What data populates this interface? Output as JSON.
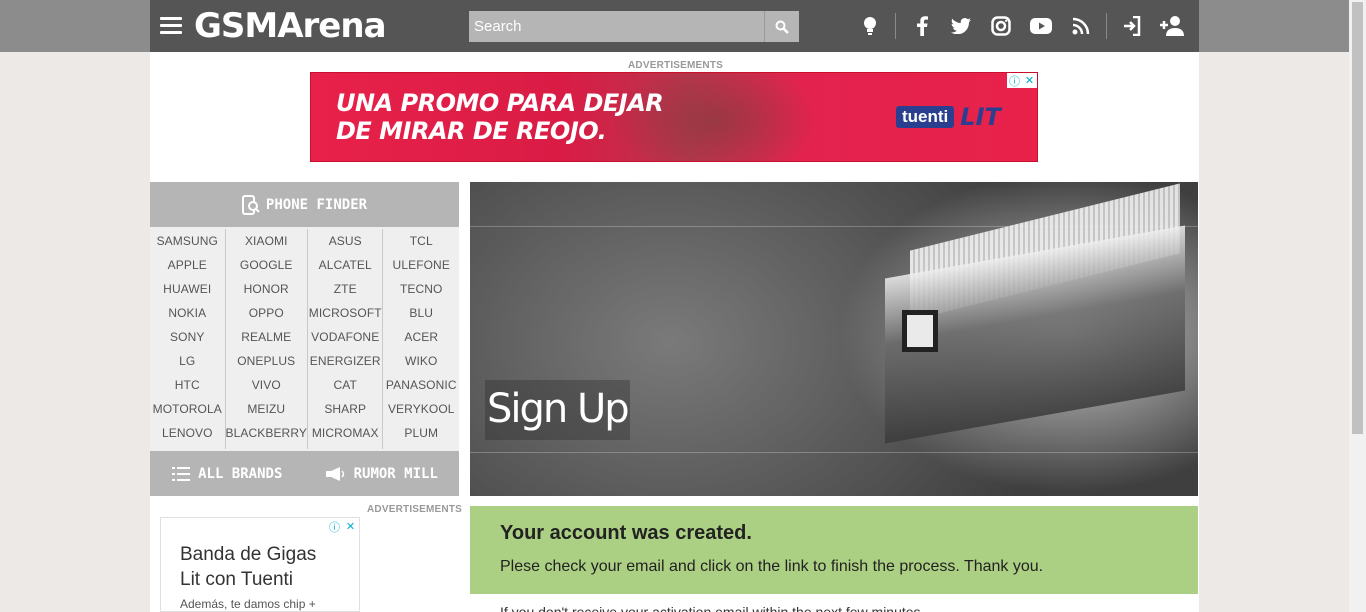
{
  "header": {
    "logo": "GSMArena",
    "search_placeholder": "Search"
  },
  "ads": {
    "label": "ADVERTISEMENTS",
    "top": {
      "line1": "UNA PROMO PARA DEJAR",
      "line2": "DE MIRAR DE REOJO.",
      "brand": "tuenti",
      "brand_suffix": "LIT"
    },
    "side": {
      "title_line1": "Banda de Gigas",
      "title_line2": "Lit con Tuenti",
      "subtitle": "Además, te damos chip +"
    }
  },
  "finder": {
    "title": "PHONE FINDER",
    "brand_columns": [
      [
        "SAMSUNG",
        "APPLE",
        "HUAWEI",
        "NOKIA",
        "SONY",
        "LG",
        "HTC",
        "MOTOROLA",
        "LENOVO"
      ],
      [
        "XIAOMI",
        "GOOGLE",
        "HONOR",
        "OPPO",
        "REALME",
        "ONEPLUS",
        "VIVO",
        "MEIZU",
        "BLACKBERRY"
      ],
      [
        "ASUS",
        "ALCATEL",
        "ZTE",
        "MICROSOFT",
        "VODAFONE",
        "ENERGIZER",
        "CAT",
        "SHARP",
        "MICROMAX"
      ],
      [
        "TCL",
        "ULEFONE",
        "TECNO",
        "BLU",
        "ACER",
        "WIKO",
        "PANASONIC",
        "VERYKOOL",
        "PLUM"
      ]
    ],
    "all_brands": "ALL BRANDS",
    "rumor_mill": "RUMOR MILL"
  },
  "hero": {
    "title": "Sign Up"
  },
  "success": {
    "title": "Your account was created.",
    "message": "Plese check your email and click on the link to finish the process. Thank you."
  },
  "below": {
    "text": "If you don't receive your activation email within the next few minutes"
  }
}
